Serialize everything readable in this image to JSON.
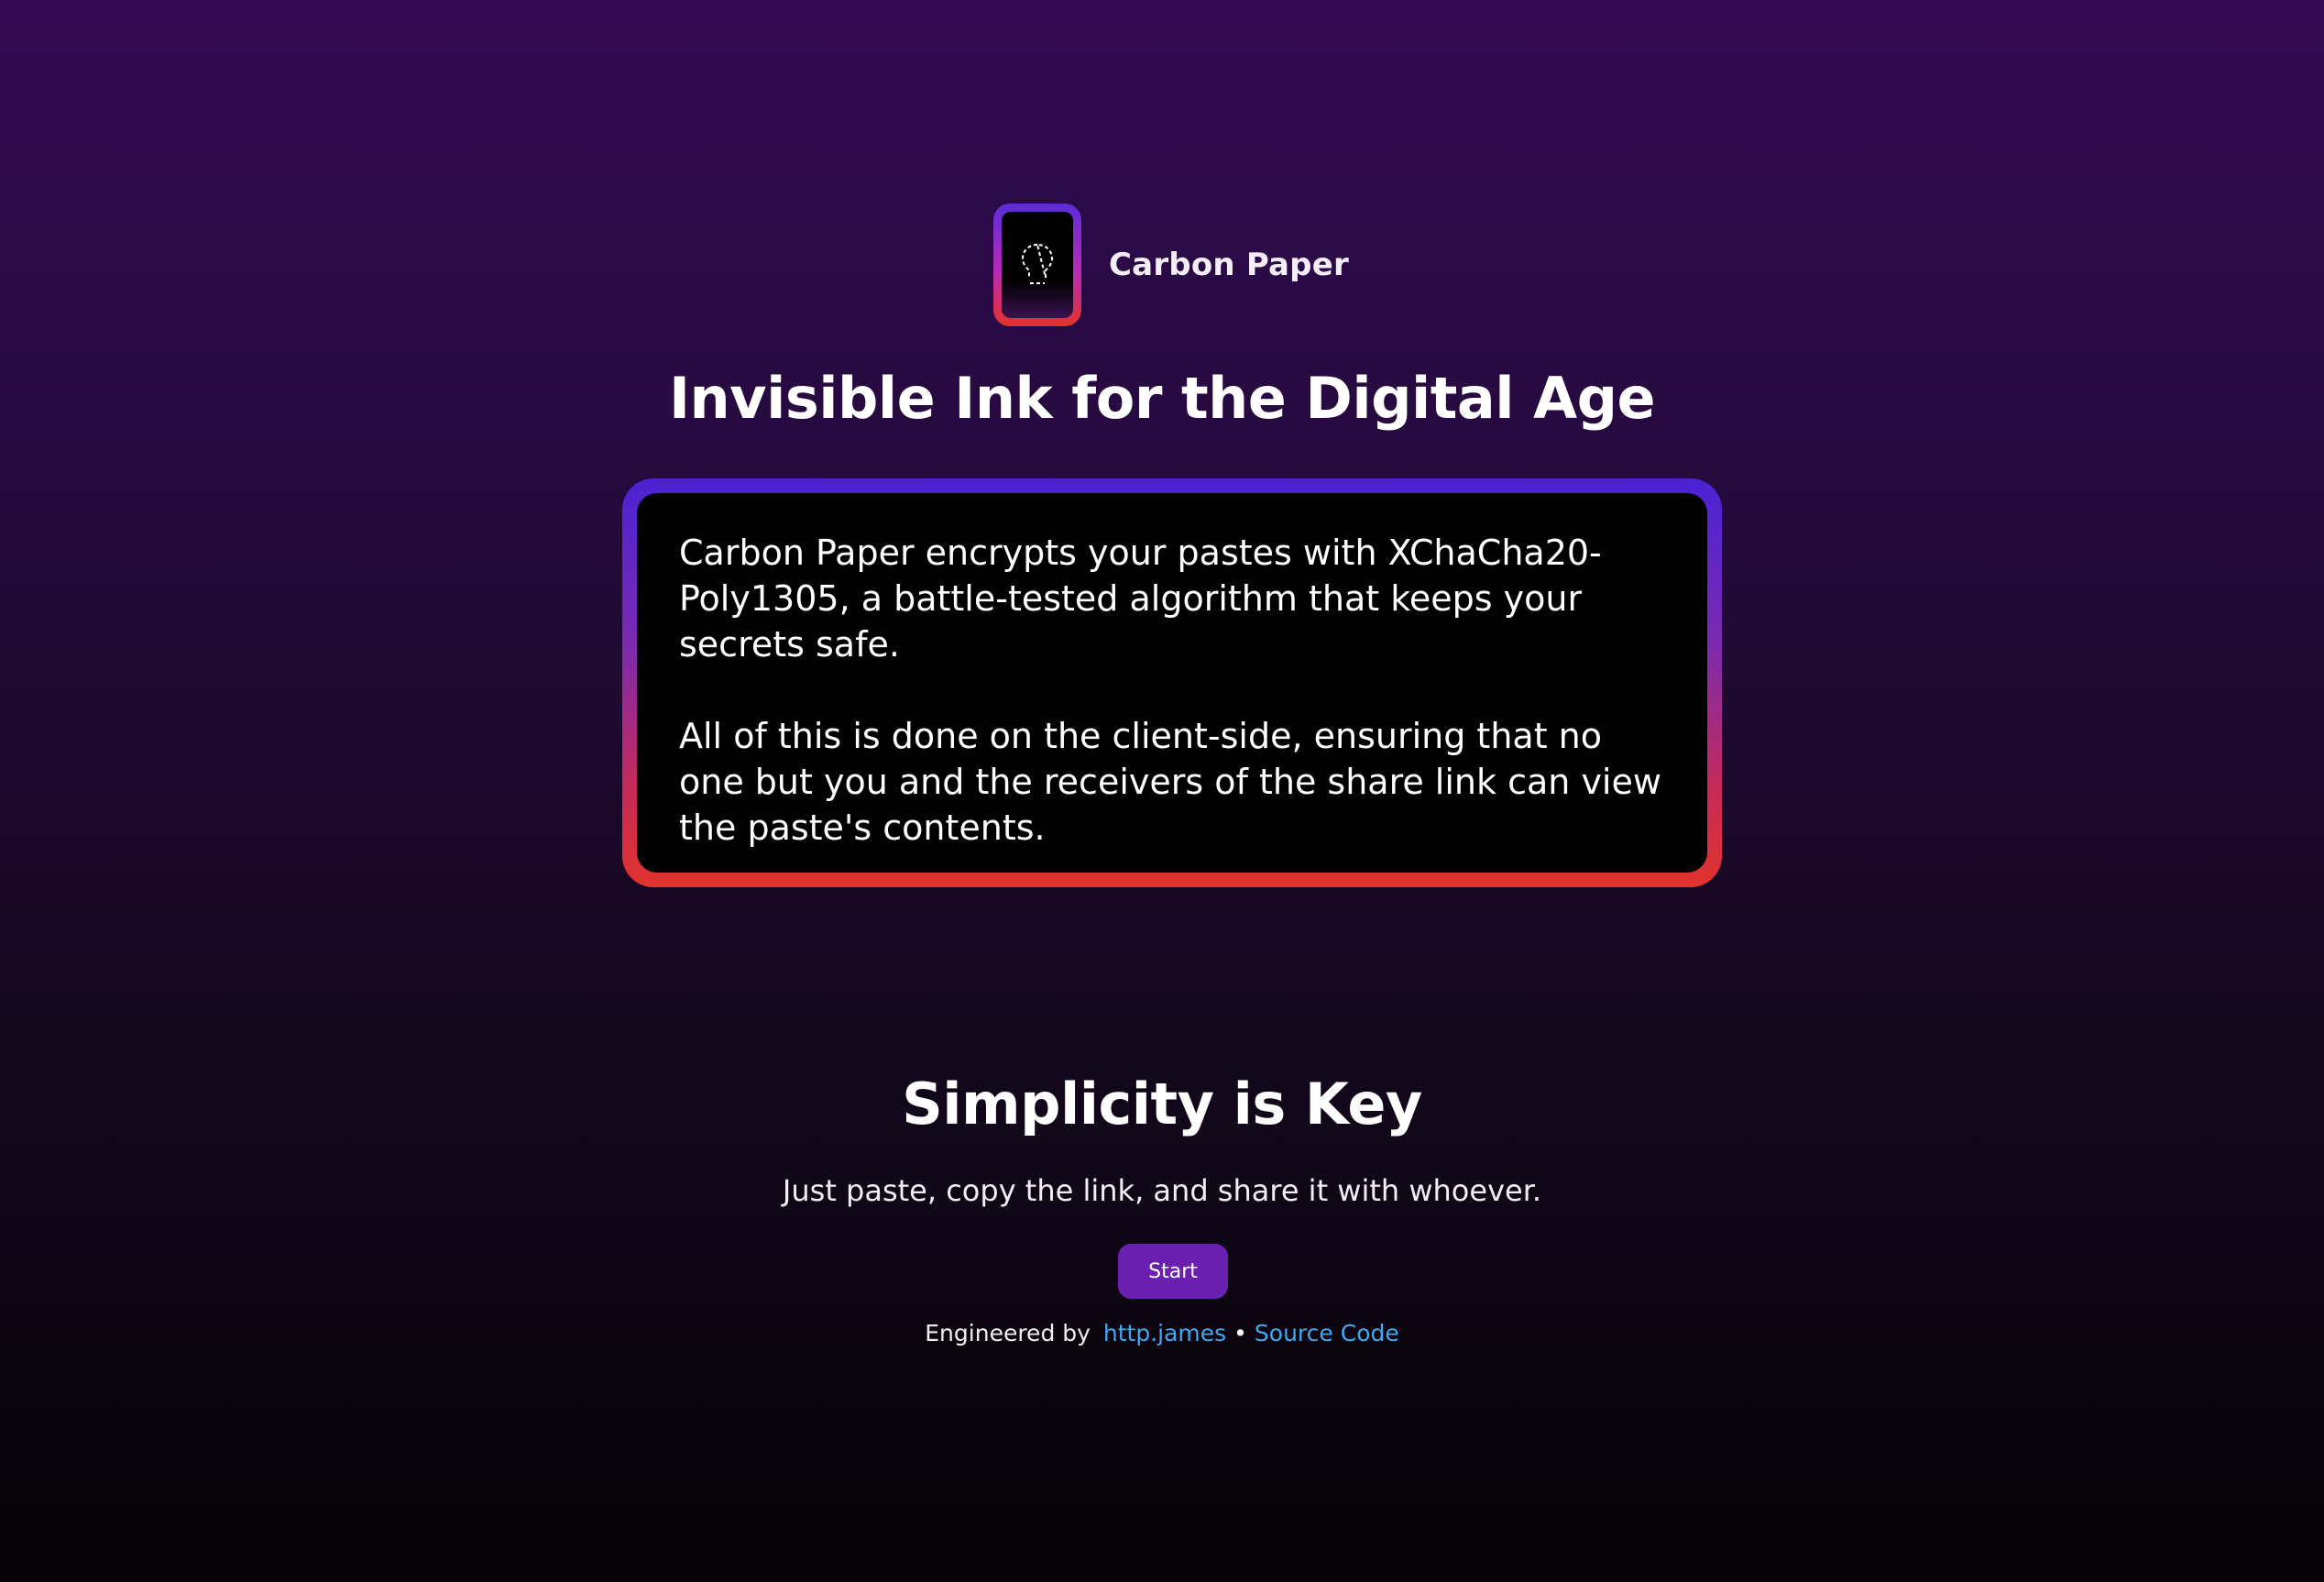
{
  "brand": {
    "name": "Carbon Paper",
    "logo_icon": "lightbulb-outline-icon",
    "gradient_colors": [
      "#5b2bd8",
      "#b82bb8",
      "#e3322a"
    ]
  },
  "hero": {
    "title": "Invisible Ink for the Digital Age",
    "paragraph_1": "Carbon Paper encrypts your pastes with XChaCha20-Poly1305, a battle-tested algorithm that keeps your secrets safe.",
    "paragraph_2": "All of this is done on the client-side, ensuring that no one but you and the receivers of the share link can view the paste's contents."
  },
  "simplicity": {
    "title": "Simplicity is Key",
    "subtitle": "Just paste, copy the link, and share it with whoever.",
    "start_label": "Start"
  },
  "footer": {
    "engineered_by_label": "Engineered by",
    "author_link": "http.james",
    "separator": "•",
    "source_link": "Source Code"
  },
  "colors": {
    "accent": "#6a1fb0",
    "link": "#3fa8f0",
    "background_top": "#320a52",
    "background_bottom": "#050306"
  }
}
